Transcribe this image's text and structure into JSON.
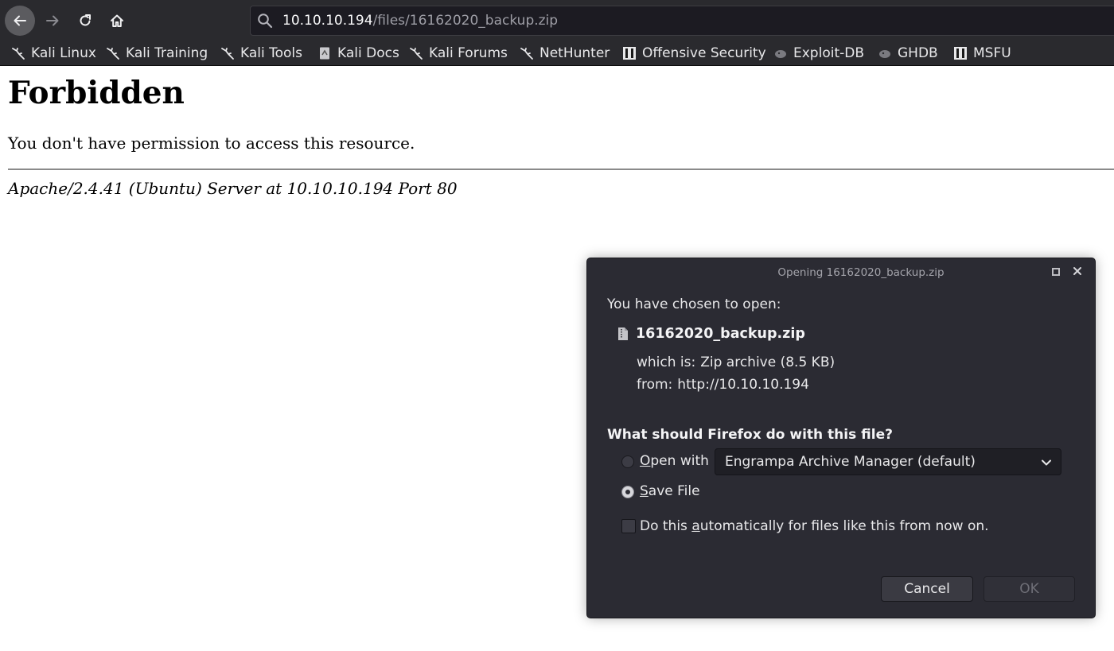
{
  "browser": {
    "url_host": "10.10.10.194",
    "url_path": "/files/16162020_backup.zip",
    "bookmarks": [
      {
        "label": "Kali Linux",
        "icon": "kali-dragon-icon"
      },
      {
        "label": "Kali Training",
        "icon": "kali-dragon-icon"
      },
      {
        "label": "Kali Tools",
        "icon": "kali-dragon-icon"
      },
      {
        "label": "Kali Docs",
        "icon": "kali-docs-icon"
      },
      {
        "label": "Kali Forums",
        "icon": "kali-dragon-icon"
      },
      {
        "label": "NetHunter",
        "icon": "kali-dragon-icon"
      },
      {
        "label": "Offensive Security",
        "icon": "offsec-icon"
      },
      {
        "label": "Exploit-DB",
        "icon": "exploit-db-icon"
      },
      {
        "label": "GHDB",
        "icon": "ghdb-icon"
      },
      {
        "label": "MSFU",
        "icon": "offsec-icon"
      }
    ]
  },
  "page": {
    "title": "Forbidden",
    "message": "You don't have permission to access this resource.",
    "footer": "Apache/2.4.41 (Ubuntu) Server at 10.10.10.194 Port 80"
  },
  "dialog": {
    "title": "Opening 16162020_backup.zip",
    "lead": "You have chosen to open:",
    "file_name": "16162020_backup.zip",
    "which_is_label": "which is:",
    "which_is_value": "Zip archive (8.5 KB)",
    "from_label": "from:",
    "from_value": "http://10.10.10.194",
    "question": "What should Firefox do with this file?",
    "open_with": {
      "mnemonic": "O",
      "rest": "pen with",
      "selected": false
    },
    "open_with_app": "Engrampa Archive Manager (default)",
    "save_file": {
      "mnemonic": "S",
      "rest": "ave File",
      "selected": true
    },
    "auto": {
      "before": "Do this ",
      "mnemonic": "a",
      "after": "utomatically for files like this from now on.",
      "checked": false
    },
    "cancel_label": "Cancel",
    "ok_label": "OK"
  },
  "colors": {
    "toolbar_bg": "#2a2a2e",
    "dialog_bg": "#2b2b33",
    "page_bg": "#ffffff"
  }
}
